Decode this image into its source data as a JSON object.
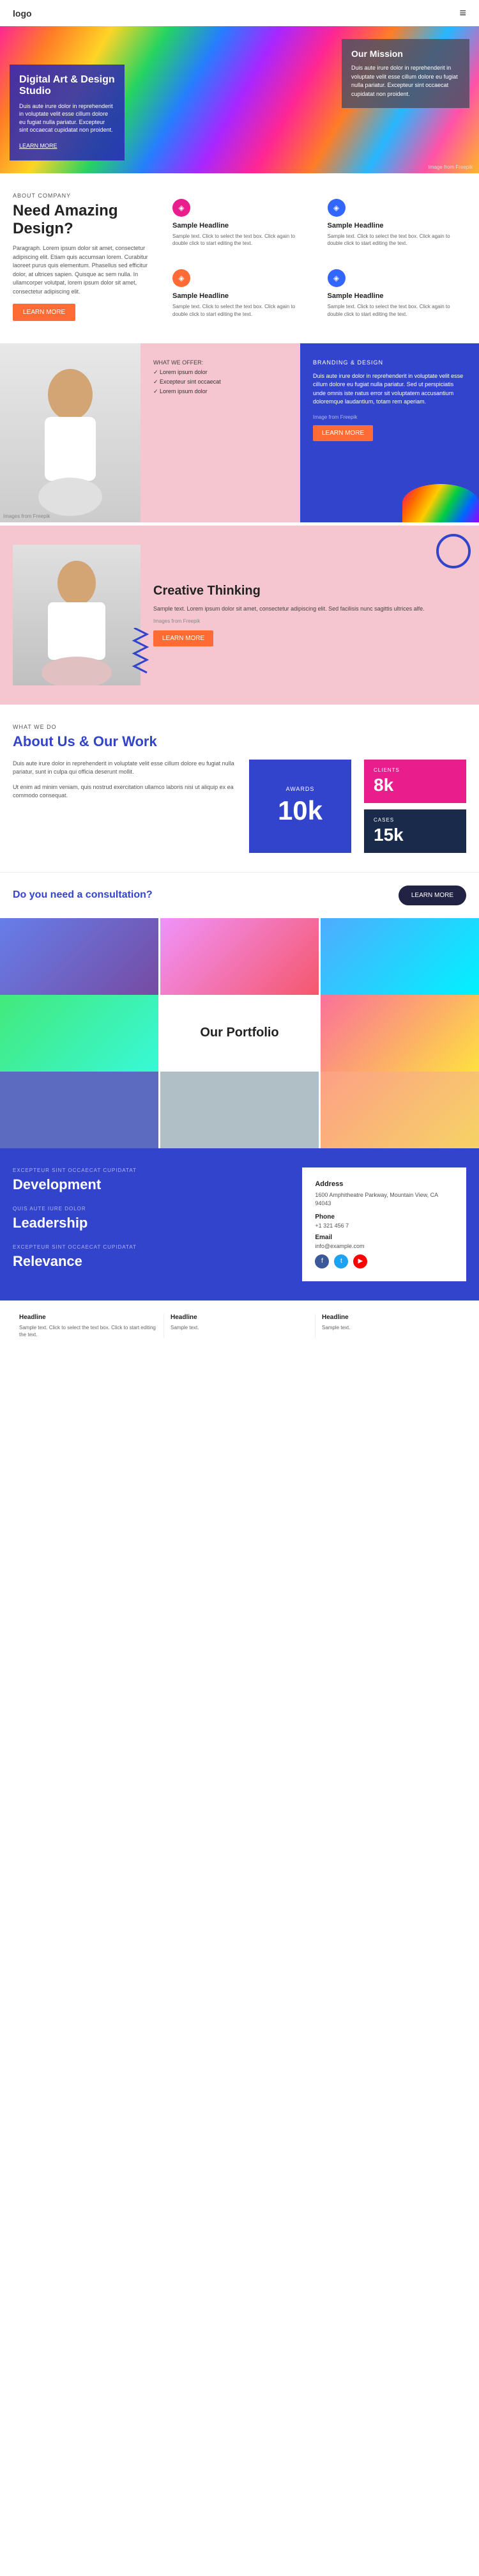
{
  "nav": {
    "logo": "logo",
    "menu_icon": "≡"
  },
  "hero": {
    "text_box": {
      "title": "Digital Art & Design Studio",
      "body": "Duis aute irure dolor in reprehenderit in voluptate velit esse cillum dolore eu fugiat nulla pariatur. Excepteur sint occaecat cupidatat non proident.",
      "learn_more": "LEARN MORE"
    },
    "mission": {
      "title": "Our Mission",
      "body": "Duis aute irure dolor in reprehenderit in voluptate velit esse cillum dolore eu fugiat nulla pariatur. Excepteur sint occaecat cupidatat non proident."
    },
    "image_credit": "Image from Freepik"
  },
  "need_design": {
    "about_label": "ABOUT COMPANY",
    "title": "Need Amazing Design?",
    "body": "Paragraph. Lorem ipsum dolor sit amet, consectetur adipiscing elit. Etiam quis accumsan lorem. Curabitur laoreet purus quis elementum. Phasellus sed efficitur dolor, at ultrices sapien. Quisque ac sem nulla. In ullamcorper volutpat, lorem ipsum dolor sit amet, consectetur adipiscing elit.",
    "learn_more": "LEARN MORE",
    "cards": [
      {
        "icon": "◈",
        "icon_class": "icon-pink",
        "title": "Sample Headline",
        "body": "Sample text. Click to select the text box. Click again to double click to start editing the text."
      },
      {
        "icon": "◈",
        "icon_class": "icon-blue",
        "title": "Sample Headline",
        "body": "Sample text. Click to select the text box. Click again to double click to start editing the text."
      },
      {
        "icon": "◈",
        "icon_class": "icon-orange",
        "title": "Sample Headline",
        "body": "Sample text. Click to select the text box. Click again to double click to start editing the text."
      },
      {
        "icon": "◈",
        "icon_class": "icon-blue",
        "title": "Sample Headline",
        "body": "Sample text. Click to select the text box. Click again to double click to start editing the text."
      }
    ]
  },
  "branding": {
    "what_label": "WHAT WE OFFER:",
    "offer_items": [
      "✓ Lorem ipsum dolor",
      "✓ Excepteur sint occaecat",
      "✓ Lorem ipsum dolor"
    ],
    "image_credit": "Images from Freepik",
    "brand_label": "BRANDING & DESIGN",
    "brand_title": "BRANDING & DESIGN",
    "brand_body": "Duis aute irure dolor in reprehenderit in voluptate velit esse cillum dolore eu fugiat nulla pariatur. Sed ut perspiciatis unde omnis iste natus error sit voluptatem accusantium doloremque laudantium, totam rem aperiam.",
    "brand_img_credit": "Image from Freepik",
    "learn_more": "LEARN MORE"
  },
  "creative": {
    "title": "Creative Thinking",
    "body": "Sample text. Lorem ipsum dolor sit amet, consectetur adipiscing elit. Sed facilisis nunc sagittis ultrices alfe.",
    "image_credit": "Images from Freepik",
    "learn_more": "LEARN MORE"
  },
  "about_work": {
    "what_label": "WHAT WE DO",
    "title": "About Us & Our Work",
    "para1": "Duis aute irure dolor in reprehenderit in voluptate velit esse cillum dolore eu fugiat nulla pariatur, sunt in culpa qui officia deserunt mollit.",
    "para2": "Ut enim ad minim veniam, quis nostrud exercitation ullamco laboris nisi ut aliquip ex ea commodo consequat.",
    "award_label": "AWARDS",
    "award_num": "10k",
    "stats": [
      {
        "label": "CLIENTS",
        "num": "8k",
        "class": "pink"
      },
      {
        "label": "CASES",
        "num": "15k",
        "class": "dark-blue"
      }
    ]
  },
  "consultation": {
    "text": "Do you need a consultation?",
    "btn": "LEARN MORE"
  },
  "portfolio": {
    "title": "Our Portfolio"
  },
  "footer_sections": [
    {
      "subtitle": "EXCEPTEUR SINT OCCAECAT CUPIDATAT",
      "title": "Development"
    },
    {
      "subtitle": "QUIS AUTE IURE DOLOR",
      "title": "Leadership"
    },
    {
      "subtitle": "EXCEPTEUR SINT OCCAECAT CUPIDATAT",
      "title": "Relevance"
    }
  ],
  "contact": {
    "address_label": "Address",
    "address_text": "1600 Amphitheatre Parkway, Mountain View, CA 94043",
    "phone_label": "Phone",
    "phone_val": "+1 321 456 7",
    "email_label": "Email",
    "email_val": "info@example.com"
  },
  "bottom_cols": [
    {
      "title": "Headline",
      "body": "Sample text. Click to select the text box. Click to start editing the text."
    },
    {
      "title": "Headline",
      "body": "Sample text."
    },
    {
      "title": "Headline",
      "body": "Sample text."
    }
  ]
}
